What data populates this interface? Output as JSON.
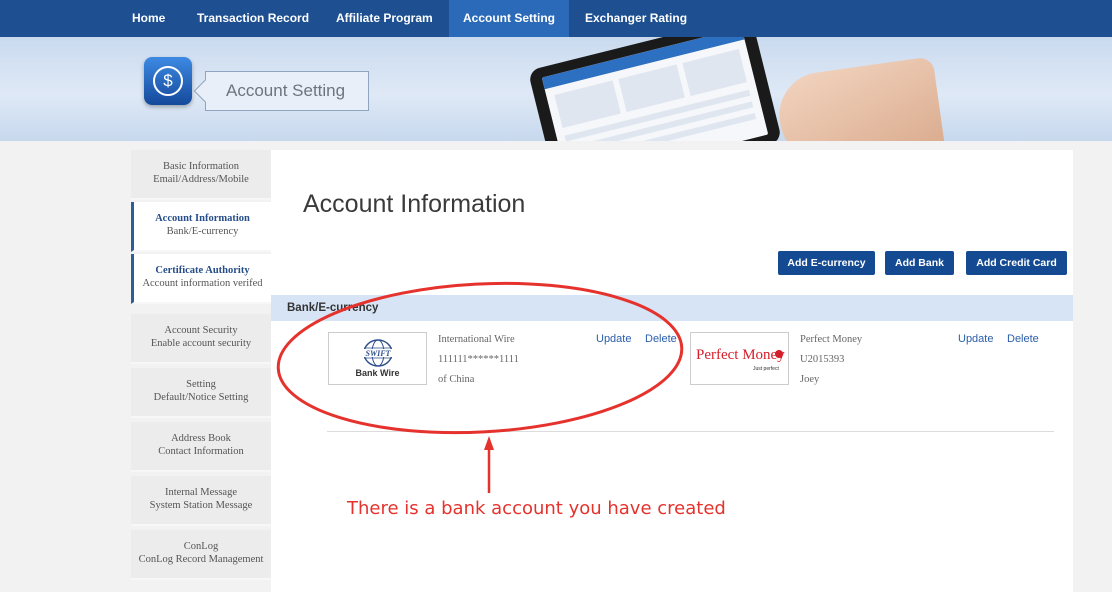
{
  "nav": {
    "items": [
      {
        "label": "Home"
      },
      {
        "label": "Transaction Record"
      },
      {
        "label": "Affiliate Program"
      },
      {
        "label": "Account Setting"
      },
      {
        "label": "Exchanger Rating"
      }
    ],
    "active": "Account Setting"
  },
  "banner": {
    "icon": "dollar-icon",
    "title": "Account Setting"
  },
  "sidebar": {
    "items": [
      {
        "title": "Basic Information",
        "subtitle": "Email/Address/Mobile"
      },
      {
        "title": "Account Information",
        "subtitle": "Bank/E-currency"
      },
      {
        "title": "Certificate Authority",
        "subtitle": "Account information verifed"
      },
      {
        "title": "Account Security",
        "subtitle": "Enable account security"
      },
      {
        "title": "Setting",
        "subtitle": "Default/Notice Setting"
      },
      {
        "title": "Address Book",
        "subtitle": "Contact Information"
      },
      {
        "title": "Internal Message",
        "subtitle": "System Station Message"
      },
      {
        "title": "ConLog",
        "subtitle": "ConLog Record Management"
      }
    ],
    "active": [
      "Account Information",
      "Certificate Authority"
    ]
  },
  "main": {
    "title": "Account Information",
    "buttons": {
      "add_ecurrency": "Add E-currency",
      "add_bank": "Add Bank",
      "add_credit_card": "Add Credit Card"
    },
    "section_title": "Bank/E-currency",
    "accounts": [
      {
        "logo_text": "SWIFT",
        "logo_caption": "Bank Wire",
        "lines": [
          "International Wire",
          "111111******1111",
          "of China"
        ],
        "update": "Update",
        "delete": "Delete"
      },
      {
        "logo_text": "Perfect Money",
        "logo_caption": "Just perfect",
        "lines": [
          "Perfect Money",
          "U2015393",
          "Joey"
        ],
        "update": "Update",
        "delete": "Delete"
      }
    ]
  },
  "annotation": {
    "text": "There is a bank account you have created",
    "color": "#e5322d"
  },
  "colors": {
    "nav_bg": "#1d4f91",
    "nav_active": "#2b6ab8",
    "button_bg": "#144a92",
    "section_bg": "#d6e4f5",
    "link": "#2a5ea8"
  }
}
